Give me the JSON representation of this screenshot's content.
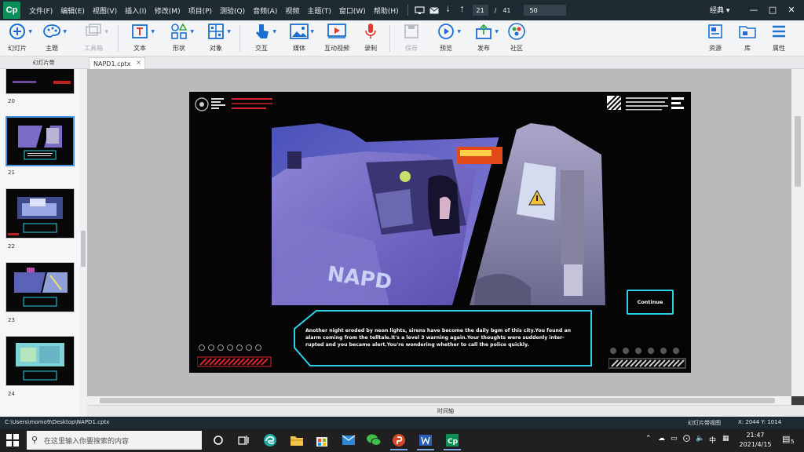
{
  "colors": {
    "menubar_bg": "#1f2b33",
    "accent": "#1b6fd0",
    "hud_cyan": "#2ad0e6",
    "hud_red": "#d9232d",
    "logo_green": "#0b8f58"
  },
  "app": {
    "logo": "Cp",
    "mode_label": "经典"
  },
  "menu": [
    "文件(F)",
    "编辑(E)",
    "视图(V)",
    "插入(I)",
    "修改(M)",
    "项目(P)",
    "测验(Q)",
    "音频(A)",
    "视频",
    "主题(T)",
    "窗口(W)",
    "帮助(H)"
  ],
  "pager": {
    "current": "21",
    "separator": "/",
    "total": "41",
    "zoom": "50"
  },
  "toolbar": {
    "slide": "幻灯片",
    "theme": "主题",
    "toolbox": "工具箱",
    "text": "文本",
    "shapes": "形状",
    "objects": "对象",
    "interactions": "交互",
    "media": "媒体",
    "interactive_video": "互动视频",
    "record": "录制",
    "save": "保存",
    "preview": "预览",
    "publish": "发布",
    "community": "社区",
    "assets": "资源",
    "library": "库",
    "properties": "属性"
  },
  "filmstrip": {
    "title": "幻灯片带",
    "slides": [
      "20",
      "21",
      "22",
      "23",
      "24"
    ],
    "selected": "21"
  },
  "document": {
    "tab": "NAPD1.cptx",
    "close": "×"
  },
  "slide": {
    "dialog": "Another night eroded by neon lights, sirens have become the daily bgm of this city.You found an alarm coming from the telltale.It's a level 3 warning again.Your thoughts were suddenly inter-rupted and you became alert.You're wondering whether to call the police quickly.",
    "continue": "Continue",
    "car_text": "NAPD"
  },
  "timeline_label": "时间轴",
  "status": {
    "path": "C:\\Users\\momo9\\Desktop\\NAPD1.cptx",
    "view": "幻灯片带视图",
    "coords": "X: 2044 Y: 1014"
  },
  "taskbar": {
    "search_placeholder": "在这里输入你要搜索的内容",
    "ime": "中",
    "time": "21:47",
    "date": "2021/4/15",
    "notif_count": "5"
  }
}
